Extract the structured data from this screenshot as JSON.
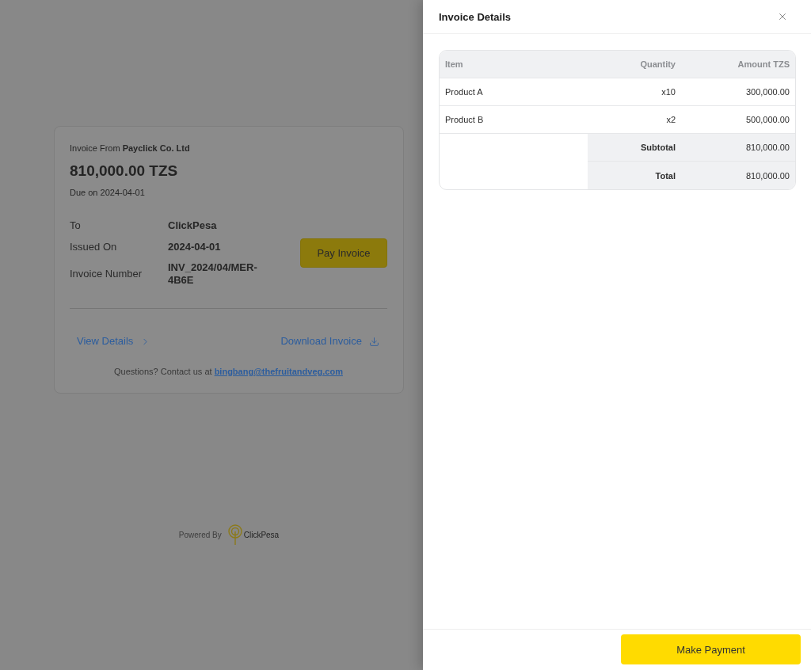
{
  "invoice_card": {
    "from": "Invoice From **Payclick Co. Ltd**",
    "amount": "810,000.00 TZS",
    "due": "Due on 2024-04-01",
    "details": [
      {
        "label": "To",
        "value": "ClickPesa"
      },
      {
        "label": "Issued On",
        "value": "2024-04-01"
      },
      {
        "label": "Invoice Number",
        "value": "INV_2024/04/MER-4B6E"
      }
    ],
    "pay_button": "Pay Invoice",
    "view_details": "View Details",
    "download": "Download Invoice",
    "contact_text": "Questions? Contact us at",
    "contact_email": "bingbang@thefruitandveg.com"
  },
  "powered_by": {
    "label": "Powered By",
    "brand": "ClickPesa"
  },
  "details_panel": {
    "title": "Invoice Details",
    "table": {
      "columns": [
        "Item",
        "Quantity",
        "Amount TZS"
      ],
      "rows": [
        [
          "Product A",
          "x10",
          "300,000.00"
        ],
        [
          "Product B",
          "x2",
          "500,000.00"
        ]
      ],
      "summary": [
        {
          "label": "Subtotal",
          "value": "810,000.00"
        },
        {
          "label": "Total",
          "value": "810,000.00"
        }
      ]
    },
    "button": "Make Payment"
  }
}
